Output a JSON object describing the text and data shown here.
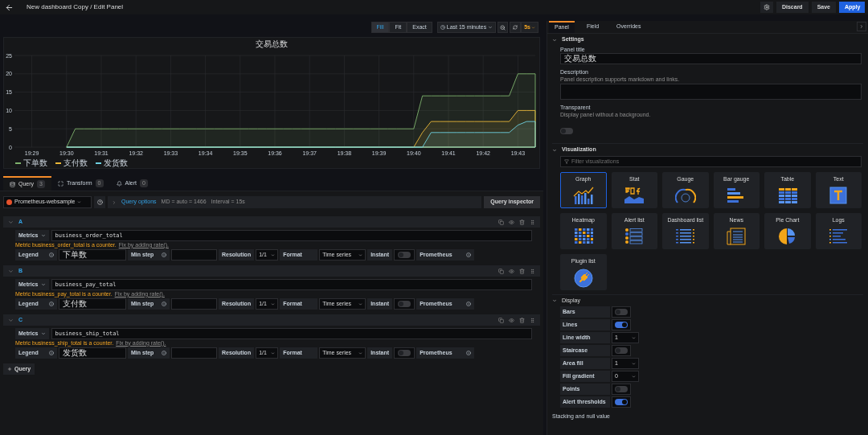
{
  "header": {
    "title": "New dashboard Copy / Edit Panel",
    "buttons": [
      {
        "label": "Discard",
        "kind": "secondary"
      },
      {
        "label": "Save",
        "kind": "secondary"
      },
      {
        "label": "Apply",
        "kind": "primary"
      }
    ]
  },
  "toolbar": {
    "fit_modes": [
      {
        "label": "Fill",
        "selected": true
      },
      {
        "label": "Fit",
        "selected": false
      },
      {
        "label": "Exact",
        "selected": false
      }
    ],
    "time_range": "Last 15 minutes",
    "refresh": "5s"
  },
  "panel": {
    "title": "交易总数",
    "chart_data": {
      "type": "area",
      "grid": true,
      "ylim": [
        0,
        25
      ],
      "yticks": [
        0,
        5,
        10,
        15,
        20,
        25
      ],
      "categories": [
        "19:29",
        null,
        null,
        null,
        "19:30",
        null,
        null,
        null,
        "19:31",
        null,
        null,
        null,
        "19:32",
        null,
        null,
        null,
        "19:33",
        null,
        null,
        null,
        "19:34",
        null,
        null,
        null,
        "19:35",
        null,
        null,
        null,
        "19:36",
        null,
        null,
        null,
        "19:37",
        null,
        null,
        null,
        "19:38",
        null,
        null,
        null,
        "19:39",
        null,
        null,
        null,
        "19:40",
        null,
        null,
        null,
        "19:41",
        null,
        null,
        null,
        "19:42",
        null,
        null,
        null,
        "19:43",
        null,
        null
      ],
      "series": [
        {
          "name": "下单数",
          "color": "#7eb26d",
          "values": [
            null,
            null,
            null,
            null,
            0,
            5,
            5,
            5,
            5,
            5,
            5,
            5,
            5,
            5,
            5,
            5,
            5,
            5,
            5,
            5,
            5,
            5,
            5,
            5,
            5,
            5,
            5,
            5,
            5,
            5,
            5,
            5,
            5,
            5,
            5,
            5,
            5,
            5,
            5,
            5,
            5,
            5,
            5,
            5,
            5,
            14,
            14,
            14,
            14,
            14,
            14,
            14,
            14,
            14,
            14,
            14,
            20,
            20,
            20
          ]
        },
        {
          "name": "支付数",
          "color": "#eab839",
          "values": [
            null,
            null,
            null,
            null,
            0,
            0,
            0,
            0,
            0,
            0,
            0,
            0,
            0,
            0,
            0,
            0,
            0,
            0,
            0,
            0,
            0,
            0,
            0,
            0,
            0,
            0,
            0,
            0,
            0,
            0,
            0,
            0,
            0,
            0,
            0,
            0,
            0,
            0,
            0,
            0,
            0,
            0,
            0,
            0,
            0,
            4,
            7,
            7,
            7,
            7,
            7,
            7,
            7,
            7,
            7,
            7,
            10,
            10,
            10
          ]
        },
        {
          "name": "发货数",
          "color": "#6ed0e0",
          "values": [
            null,
            null,
            null,
            null,
            0,
            0,
            0,
            0,
            0,
            0,
            0,
            0,
            0,
            0,
            0,
            0,
            0,
            0,
            0,
            0,
            0,
            0,
            0,
            0,
            0,
            0,
            0,
            0,
            0,
            0,
            0,
            0,
            0,
            0,
            0,
            0,
            0,
            0,
            0,
            0,
            0,
            0,
            0,
            0,
            0,
            0,
            4,
            4,
            4,
            4,
            4,
            4,
            4,
            4,
            4,
            4,
            6,
            7,
            7
          ]
        }
      ]
    }
  },
  "query_tabs": [
    {
      "label": "Query",
      "count": "3",
      "selected": true
    },
    {
      "label": "Transform",
      "count": "0",
      "selected": false
    },
    {
      "label": "Alert",
      "count": "0",
      "selected": false
    }
  ],
  "datasource": "Prometheus-websample",
  "query_options": {
    "label": "Query options",
    "md": "MD = auto = 1466",
    "interval": "Interval = 15s"
  },
  "query_inspector": "Query inspector",
  "queries": [
    {
      "ref": "A",
      "metrics_label": "Metrics",
      "metric": "business_order_total",
      "warning": "Metric business_order_total is a counter.",
      "fix_link": "Fix by adding rate().",
      "legend_label": "Legend",
      "legend": "下单数",
      "min_step_label": "Min step",
      "resolution_label": "Resolution",
      "resolution": "1/1",
      "format_label": "Format",
      "format": "Time series",
      "instant_label": "Instant",
      "instant": false,
      "source_label": "Prometheus"
    },
    {
      "ref": "B",
      "metrics_label": "Metrics",
      "metric": "business_pay_total",
      "warning": "Metric business_pay_total is a counter.",
      "fix_link": "Fix by adding rate().",
      "legend_label": "Legend",
      "legend": "支付数",
      "min_step_label": "Min step",
      "resolution_label": "Resolution",
      "resolution": "1/1",
      "format_label": "Format",
      "format": "Time series",
      "instant_label": "Instant",
      "instant": false,
      "source_label": "Prometheus"
    },
    {
      "ref": "C",
      "metrics_label": "Metrics",
      "metric": "business_ship_total",
      "warning": "Metric business_ship_total is a counter.",
      "fix_link": "Fix by adding rate().",
      "legend_label": "Legend",
      "legend": "发货数",
      "min_step_label": "Min step",
      "resolution_label": "Resolution",
      "resolution": "1/1",
      "format_label": "Format",
      "format": "Time series",
      "instant_label": "Instant",
      "instant": false,
      "source_label": "Prometheus"
    }
  ],
  "add_query": "Query",
  "options_tabs": [
    {
      "label": "Panel",
      "selected": true
    },
    {
      "label": "Field",
      "selected": false
    },
    {
      "label": "Overrides",
      "selected": false
    }
  ],
  "settings": {
    "heading": "Settings",
    "panel_title_label": "Panel title",
    "panel_title": "交易总数",
    "description_label": "Description",
    "description_hint": "Panel description supports markdown and links.",
    "transparent_label": "Transparent",
    "transparent_hint": "Display panel without a background.",
    "transparent": false
  },
  "visualization": {
    "heading": "Visualization",
    "filter_placeholder": "Filter visualizations",
    "items": [
      {
        "label": "Graph",
        "selected": true
      },
      {
        "label": "Stat",
        "selected": false
      },
      {
        "label": "Gauge",
        "selected": false
      },
      {
        "label": "Bar gauge",
        "selected": false
      },
      {
        "label": "Table",
        "selected": false
      },
      {
        "label": "Text",
        "selected": false
      },
      {
        "label": "Heatmap",
        "selected": false
      },
      {
        "label": "Alert list",
        "selected": false
      },
      {
        "label": "Dashboard list",
        "selected": false
      },
      {
        "label": "News",
        "selected": false
      },
      {
        "label": "Pie Chart",
        "selected": false
      },
      {
        "label": "Logs",
        "selected": false
      },
      {
        "label": "Plugin list",
        "selected": false
      }
    ]
  },
  "display": {
    "heading": "Display",
    "options": [
      {
        "label": "Bars",
        "kind": "switch",
        "on": false
      },
      {
        "label": "Lines",
        "kind": "switch",
        "on": true
      },
      {
        "label": "Line width",
        "kind": "select",
        "value": "1"
      },
      {
        "label": "Staircase",
        "kind": "switch",
        "on": false
      },
      {
        "label": "Area fill",
        "kind": "select",
        "value": "1"
      },
      {
        "label": "Fill gradient",
        "kind": "select",
        "value": "0"
      },
      {
        "label": "Points",
        "kind": "switch",
        "on": false
      },
      {
        "label": "Alert thresholds",
        "kind": "switch",
        "on": true
      }
    ]
  },
  "next_section": "Stacking and null value"
}
